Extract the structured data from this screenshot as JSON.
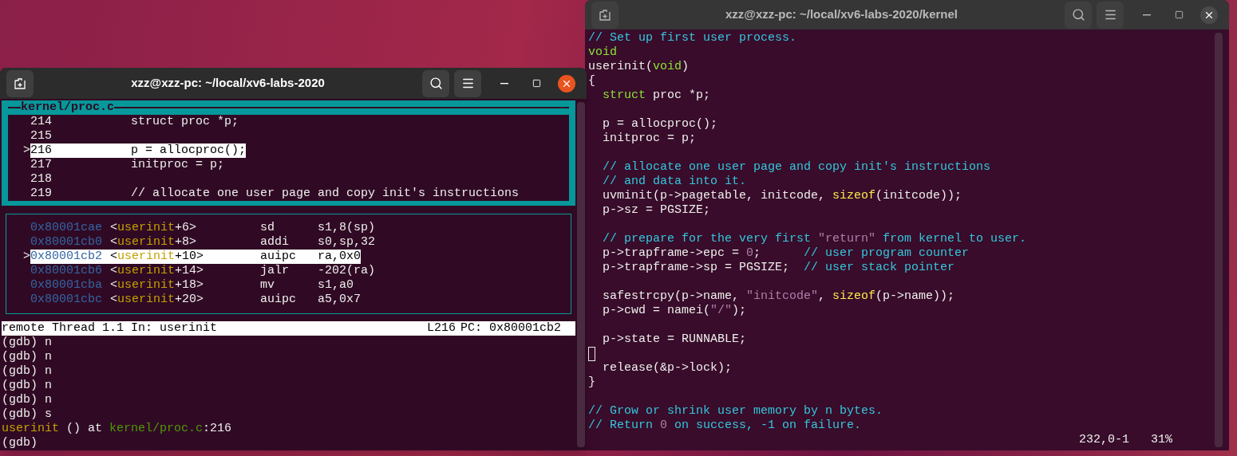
{
  "gdb_window": {
    "title": "xzz@xzz-pc: ~/local/xv6-labs-2020",
    "source_panel": {
      "title": "kernel/proc.c",
      "lines": [
        {
          "number": "214",
          "code": [
            {
              "text": "struct proc *p;",
              "kind": "plain"
            }
          ],
          "current": false
        },
        {
          "number": "215",
          "current": false
        },
        {
          "number": "216",
          "marker": ">",
          "code": [
            {
              "text": "p = allocproc();",
              "kind": "plain"
            }
          ],
          "current": true
        },
        {
          "number": "217",
          "code": [
            {
              "text": "initproc = p;",
              "kind": "plain"
            }
          ],
          "current": false
        },
        {
          "number": "218",
          "current": false
        },
        {
          "number": "219",
          "code": [
            {
              "text": "// allocate one user page and copy init's instructions",
              "kind": "plain"
            }
          ],
          "current": false
        }
      ]
    },
    "asm_panel": {
      "rows": [
        {
          "address": "0x80001cae",
          "symbol": [
            {
              "text": "<",
              "kind": "plain"
            },
            {
              "text": "userinit",
              "kind": "func"
            },
            {
              "text": "+6>",
              "kind": "plain"
            }
          ],
          "mnemonic": "sd",
          "operands": "s1,8(sp)",
          "current": false
        },
        {
          "address": "0x80001cb0",
          "symbol": [
            {
              "text": "<",
              "kind": "plain"
            },
            {
              "text": "userinit",
              "kind": "func"
            },
            {
              "text": "+8>",
              "kind": "plain"
            }
          ],
          "mnemonic": "addi",
          "operands": "s0,sp,32",
          "current": false
        },
        {
          "address": "0x80001cb2",
          "marker": ">",
          "symbol": [
            {
              "text": "<",
              "kind": "plain"
            },
            {
              "text": "userinit",
              "kind": "func"
            },
            {
              "text": "+10>",
              "kind": "plain"
            }
          ],
          "mnemonic": "auipc",
          "operands": "ra,0x0",
          "current": true
        },
        {
          "address": "0x80001cb6",
          "symbol": [
            {
              "text": "<",
              "kind": "plain"
            },
            {
              "text": "userinit",
              "kind": "func"
            },
            {
              "text": "+14>",
              "kind": "plain"
            }
          ],
          "mnemonic": "jalr",
          "operands": "-202(ra)",
          "current": false
        },
        {
          "address": "0x80001cba",
          "symbol": [
            {
              "text": "<",
              "kind": "plain"
            },
            {
              "text": "userinit",
              "kind": "func"
            },
            {
              "text": "+18>",
              "kind": "plain"
            }
          ],
          "mnemonic": "mv",
          "operands": "s1,a0",
          "current": false
        },
        {
          "address": "0x80001cbc",
          "symbol": [
            {
              "text": "<",
              "kind": "plain"
            },
            {
              "text": "userinit",
              "kind": "func"
            },
            {
              "text": "+20>",
              "kind": "plain"
            }
          ],
          "mnemonic": "auipc",
          "operands": "a5,0x7",
          "current": false
        }
      ]
    },
    "status_line": {
      "thread": "remote Thread 1.1 In: userinit",
      "line": "L216",
      "pc": "PC: 0x80001cb2"
    },
    "console": [
      [
        {
          "text": "(gdb) n",
          "kind": "plain"
        }
      ],
      [
        {
          "text": "(gdb) n",
          "kind": "plain"
        }
      ],
      [
        {
          "text": "(gdb) n",
          "kind": "plain"
        }
      ],
      [
        {
          "text": "(gdb) n",
          "kind": "plain"
        }
      ],
      [
        {
          "text": "(gdb) n",
          "kind": "plain"
        }
      ],
      [
        {
          "text": "(gdb) s",
          "kind": "plain"
        }
      ],
      [
        {
          "text": "userinit",
          "kind": "func"
        },
        {
          "text": " () at ",
          "kind": "plain"
        },
        {
          "text": "kernel/proc.c",
          "kind": "file"
        },
        {
          "text": ":216",
          "kind": "plain"
        }
      ],
      [
        {
          "text": "(gdb)",
          "kind": "plain"
        }
      ]
    ]
  },
  "vim_window": {
    "title": "xzz@xzz-pc: ~/local/xv6-labs-2020/kernel",
    "lines": [
      {
        "code": [
          {
            "text": "// Set up first user process.",
            "kind": "comment"
          }
        ],
        "cursor": false
      },
      {
        "code": [
          {
            "text": "void",
            "kind": "type"
          }
        ],
        "cursor": false
      },
      {
        "code": [
          {
            "text": "userinit(",
            "kind": "plain"
          },
          {
            "text": "void",
            "kind": "type"
          },
          {
            "text": ")",
            "kind": "plain"
          }
        ],
        "cursor": false
      },
      {
        "code": [
          {
            "text": "{",
            "kind": "plain"
          }
        ],
        "cursor": false
      },
      {
        "code": [
          {
            "text": "  struct",
            "kind": "type"
          },
          {
            "text": " proc *p;",
            "kind": "plain"
          }
        ],
        "cursor": false
      },
      {
        "cursor": false
      },
      {
        "code": [
          {
            "text": "  p = allocproc();",
            "kind": "plain"
          }
        ],
        "cursor": false
      },
      {
        "code": [
          {
            "text": "  initproc = p;",
            "kind": "plain"
          }
        ],
        "cursor": false
      },
      {
        "cursor": false
      },
      {
        "code": [
          {
            "text": "  // allocate one user page and copy init's instructions",
            "kind": "comment"
          }
        ],
        "cursor": false
      },
      {
        "code": [
          {
            "text": "  // and data into it.",
            "kind": "comment"
          }
        ],
        "cursor": false
      },
      {
        "code": [
          {
            "text": "  uvminit(p->pagetable, initcode, ",
            "kind": "plain"
          },
          {
            "text": "sizeof",
            "kind": "builtin"
          },
          {
            "text": "(initcode));",
            "kind": "plain"
          }
        ],
        "cursor": false
      },
      {
        "code": [
          {
            "text": "  p->sz = PGSIZE;",
            "kind": "plain"
          }
        ],
        "cursor": false
      },
      {
        "cursor": false
      },
      {
        "code": [
          {
            "text": "  // prepare for the very first ",
            "kind": "comment"
          },
          {
            "text": "\"return\"",
            "kind": "string"
          },
          {
            "text": " from kernel to user.",
            "kind": "comment"
          }
        ],
        "cursor": false
      },
      {
        "code": [
          {
            "text": "  p->trapframe->epc = ",
            "kind": "plain"
          },
          {
            "text": "0",
            "kind": "number"
          },
          {
            "text": ";      ",
            "kind": "plain"
          },
          {
            "text": "// user program counter",
            "kind": "comment"
          }
        ],
        "cursor": false
      },
      {
        "code": [
          {
            "text": "  p->trapframe->sp = PGSIZE;  ",
            "kind": "plain"
          },
          {
            "text": "// user stack pointer",
            "kind": "comment"
          }
        ],
        "cursor": false
      },
      {
        "cursor": false
      },
      {
        "code": [
          {
            "text": "  safestrcpy(p->name, ",
            "kind": "plain"
          },
          {
            "text": "\"initcode\"",
            "kind": "string"
          },
          {
            "text": ", ",
            "kind": "plain"
          },
          {
            "text": "sizeof",
            "kind": "builtin"
          },
          {
            "text": "(p->name));",
            "kind": "plain"
          }
        ],
        "cursor": false
      },
      {
        "code": [
          {
            "text": "  p->cwd = namei(",
            "kind": "plain"
          },
          {
            "text": "\"/\"",
            "kind": "string"
          },
          {
            "text": ");",
            "kind": "plain"
          }
        ],
        "cursor": false
      },
      {
        "cursor": false
      },
      {
        "code": [
          {
            "text": "  p->state = RUNNABLE;",
            "kind": "plain"
          }
        ],
        "cursor": false
      },
      {
        "cursor": true
      },
      {
        "code": [
          {
            "text": "  release(&p->lock);",
            "kind": "plain"
          }
        ],
        "cursor": false
      },
      {
        "code": [
          {
            "text": "}",
            "kind": "plain"
          }
        ],
        "cursor": false
      },
      {
        "cursor": false
      },
      {
        "code": [
          {
            "text": "// Grow or shrink user memory by n bytes.",
            "kind": "comment"
          }
        ],
        "cursor": false
      },
      {
        "code": [
          {
            "text": "// Return ",
            "kind": "comment"
          },
          {
            "text": "0",
            "kind": "number"
          },
          {
            "text": " on success, -1 on failure.",
            "kind": "comment"
          }
        ],
        "cursor": false
      }
    ],
    "ruler": {
      "position": "232,0-1",
      "percent": "31%"
    }
  }
}
